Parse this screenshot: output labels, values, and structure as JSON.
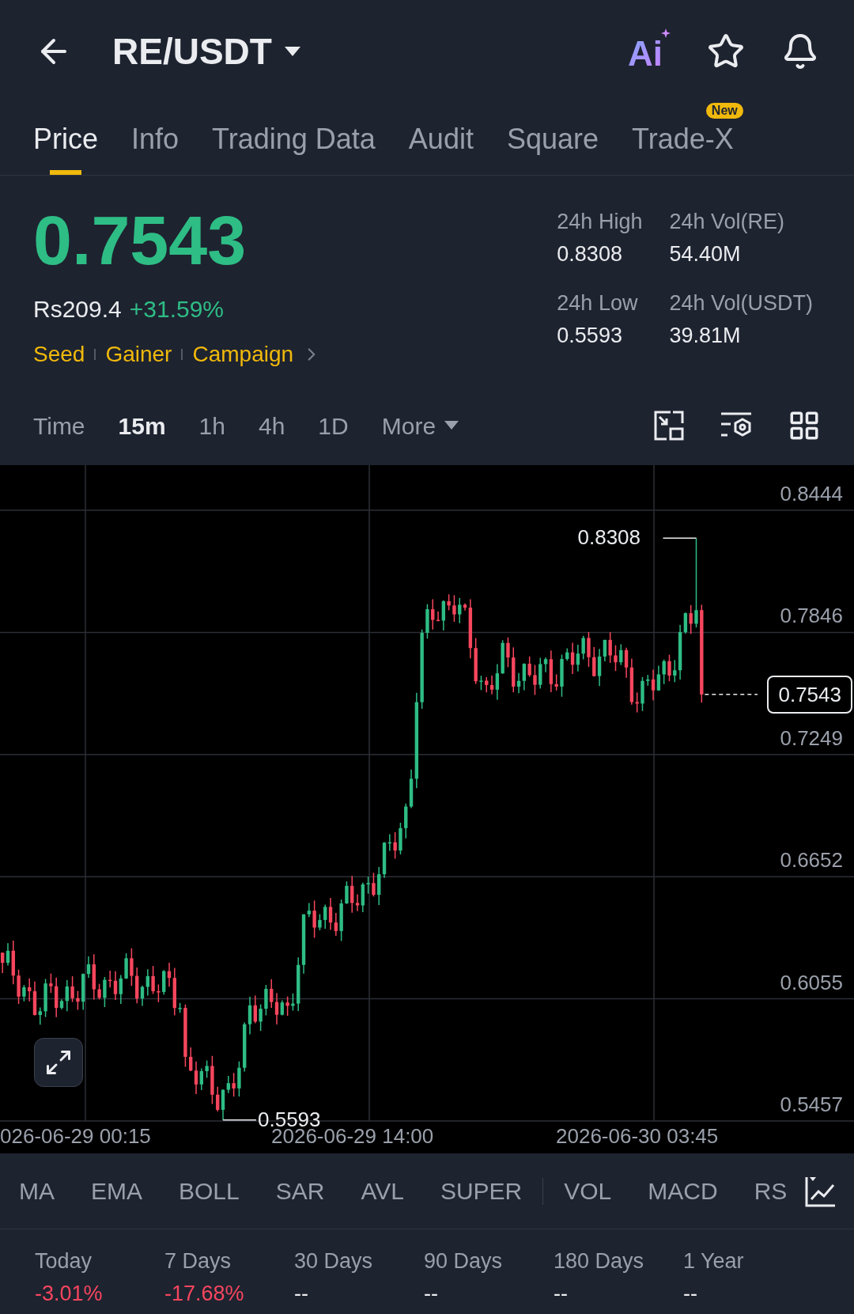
{
  "header": {
    "pair": "RE/USDT",
    "ai_label": "Ai"
  },
  "tabs": [
    {
      "label": "Price",
      "selected": true
    },
    {
      "label": "Info",
      "selected": false
    },
    {
      "label": "Trading Data",
      "selected": false
    },
    {
      "label": "Audit",
      "selected": false
    },
    {
      "label": "Square",
      "selected": false
    },
    {
      "label": "Trade-X",
      "selected": false,
      "badge": "New"
    }
  ],
  "price": {
    "last": "0.7543",
    "fiat": "Rs209.4",
    "change": "+31.59%",
    "tags": [
      "Seed",
      "Gainer",
      "Campaign"
    ]
  },
  "stats": [
    {
      "label": "24h High",
      "value": "0.8308"
    },
    {
      "label": "24h Vol(RE)",
      "value": "54.40M"
    },
    {
      "label": "24h Low",
      "value": "0.5593"
    },
    {
      "label": "24h Vol(USDT)",
      "value": "39.81M"
    }
  ],
  "intervals": [
    {
      "label": "Time",
      "selected": false
    },
    {
      "label": "15m",
      "selected": true
    },
    {
      "label": "1h",
      "selected": false
    },
    {
      "label": "4h",
      "selected": false
    },
    {
      "label": "1D",
      "selected": false
    }
  ],
  "more": "More",
  "chart": {
    "y_labels": [
      "0.8444",
      "0.7846",
      "0.7249",
      "0.6652",
      "0.6055",
      "0.5457"
    ],
    "x_labels": [
      "026-06-29 00:15",
      "2026-06-29 14:00",
      "2026-06-30 03:45"
    ],
    "high_marker": "0.8308",
    "low_marker": "0.5593",
    "current_price": "0.7543"
  },
  "indicators": {
    "main": [
      "MA",
      "EMA",
      "BOLL",
      "SAR",
      "AVL",
      "SUPER"
    ],
    "sub": [
      "VOL",
      "MACD",
      "RS"
    ]
  },
  "performance": [
    {
      "label": "Today",
      "value": "-3.01%",
      "color": "#f6465d"
    },
    {
      "label": "7 Days",
      "value": "-17.68%",
      "color": "#f6465d"
    },
    {
      "label": "30 Days",
      "value": "--",
      "color": "#eaecef"
    },
    {
      "label": "90 Days",
      "value": "--",
      "color": "#eaecef"
    },
    {
      "label": "180 Days",
      "value": "--",
      "color": "#eaecef"
    },
    {
      "label": "1 Year",
      "value": "--",
      "color": "#eaecef"
    }
  ]
}
